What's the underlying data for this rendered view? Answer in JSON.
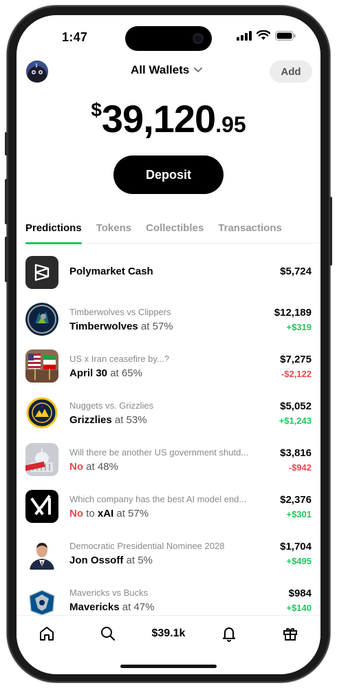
{
  "status_bar": {
    "time": "1:47"
  },
  "header": {
    "wallet_label": "All Wallets",
    "add_label": "Add"
  },
  "balance": {
    "currency": "$",
    "integer": "39,120",
    "decimal": ".95"
  },
  "deposit_label": "Deposit",
  "tabs": [
    {
      "label": "Predictions",
      "active": true
    },
    {
      "label": "Tokens",
      "active": false
    },
    {
      "label": "Collectibles",
      "active": false
    },
    {
      "label": "Transactions",
      "active": false
    }
  ],
  "positions": [
    {
      "title": "Polymarket Cash",
      "amount": "$5,724",
      "icon": "polymarket-logo-icon"
    },
    {
      "subtitle": "Timberwolves vs Clippers",
      "pick": "Timberwolves",
      "odds": "at 57%",
      "amount": "$12,189",
      "pnl": "+$319",
      "pnl_sign": "pos",
      "icon": "timberwolves-logo-icon"
    },
    {
      "subtitle": "US x Iran ceasefire by...?",
      "pick": "April 30",
      "odds": "at 65%",
      "amount": "$7,275",
      "pnl": "-$2,122",
      "pnl_sign": "neg",
      "icon": "flags-photo-icon"
    },
    {
      "subtitle": "Nuggets vs. Grizzlies",
      "pick": "Grizzlies",
      "odds": "at 53%",
      "amount": "$5,052",
      "pnl": "+$1,243",
      "pnl_sign": "pos",
      "icon": "nuggets-logo-icon"
    },
    {
      "subtitle": "Will there be another US government shutd...",
      "pick": "No",
      "pick_style": "negative",
      "odds": "at 48%",
      "amount": "$3,816",
      "pnl": "-$942",
      "pnl_sign": "neg",
      "icon": "capitol-closed-icon"
    },
    {
      "subtitle": "Which company has the best AI model end...",
      "pick": "No",
      "pick_style": "negative",
      "connector": "to",
      "target": "xAI",
      "odds": "at 57%",
      "amount": "$2,376",
      "pnl": "+$301",
      "pnl_sign": "pos",
      "icon": "xai-logo-icon"
    },
    {
      "subtitle": "Democratic Presidential Nominee 2028",
      "pick": "Jon Ossoff",
      "odds": "at 5%",
      "amount": "$1,704",
      "pnl": "+$495",
      "pnl_sign": "pos",
      "icon": "person-portrait-icon"
    },
    {
      "subtitle": "Mavericks vs Bucks",
      "pick": "Mavericks",
      "odds": "at 47%",
      "amount": "$984",
      "pnl": "+$140",
      "pnl_sign": "pos",
      "icon": "mavericks-logo-icon"
    }
  ],
  "bottom_nav": {
    "balance_short": "$39.1k"
  },
  "colors": {
    "positive": "#22c55e",
    "negative": "#e5484d",
    "tab_underline": "#22c55e"
  }
}
